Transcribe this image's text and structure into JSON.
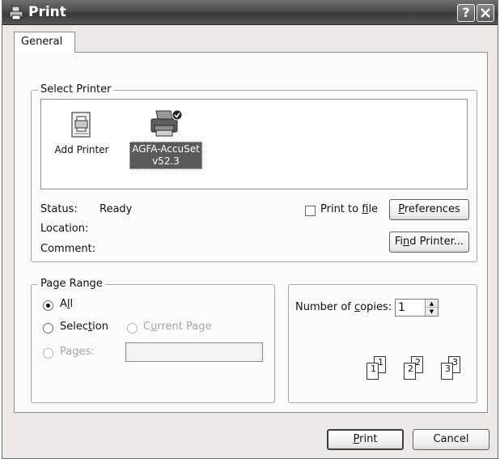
{
  "window": {
    "title": "Print",
    "help_button": "?",
    "close_button": "X"
  },
  "tabs": [
    {
      "label": "General",
      "active": true
    }
  ],
  "select_printer": {
    "legend": "Select Printer",
    "printers": [
      {
        "name": "Add Printer",
        "icon": "add-printer-icon",
        "selected": false
      },
      {
        "name_line1": "AGFA-AccuSet",
        "name_line2": "v52.3",
        "icon": "printer-default-icon",
        "selected": true
      }
    ],
    "status_label": "Status:",
    "status_value": "Ready",
    "location_label": "Location:",
    "location_value": "",
    "comment_label": "Comment:",
    "comment_value": "",
    "print_to_file": {
      "label_pre": "Print to ",
      "label_access": "f",
      "label_post": "ile",
      "checked": false
    },
    "preferences_button": {
      "access": "P",
      "rest": "references"
    },
    "find_printer_button": {
      "pre": "Fi",
      "access": "n",
      "post": "d Printer..."
    }
  },
  "page_range": {
    "legend": "Page Range",
    "all": {
      "pre": "A",
      "access": "l",
      "post": "l",
      "checked": true
    },
    "selection": {
      "pre": "Selec",
      "access": "t",
      "post": "ion",
      "checked": false
    },
    "current_page": {
      "pre": "C",
      "access": "u",
      "post": "rrent Page",
      "enabled": false
    },
    "pages": {
      "pre": "Pa",
      "access": "g",
      "post": "es:",
      "enabled": false,
      "value": ""
    }
  },
  "copies": {
    "label_pre": "Number of ",
    "label_access": "c",
    "label_post": "opies:",
    "value": "1",
    "collate_pages": [
      "1",
      "1",
      "2",
      "2",
      "3",
      "3"
    ]
  },
  "footer": {
    "print_button": {
      "access": "P",
      "rest": "rint"
    },
    "cancel_button": "Cancel"
  },
  "colors": {
    "title_bar": "#4a4a4a",
    "selection_bg": "#5a5a5a",
    "dialog_bg": "#ece9e6",
    "panel_bg": "#fbfbfb"
  }
}
